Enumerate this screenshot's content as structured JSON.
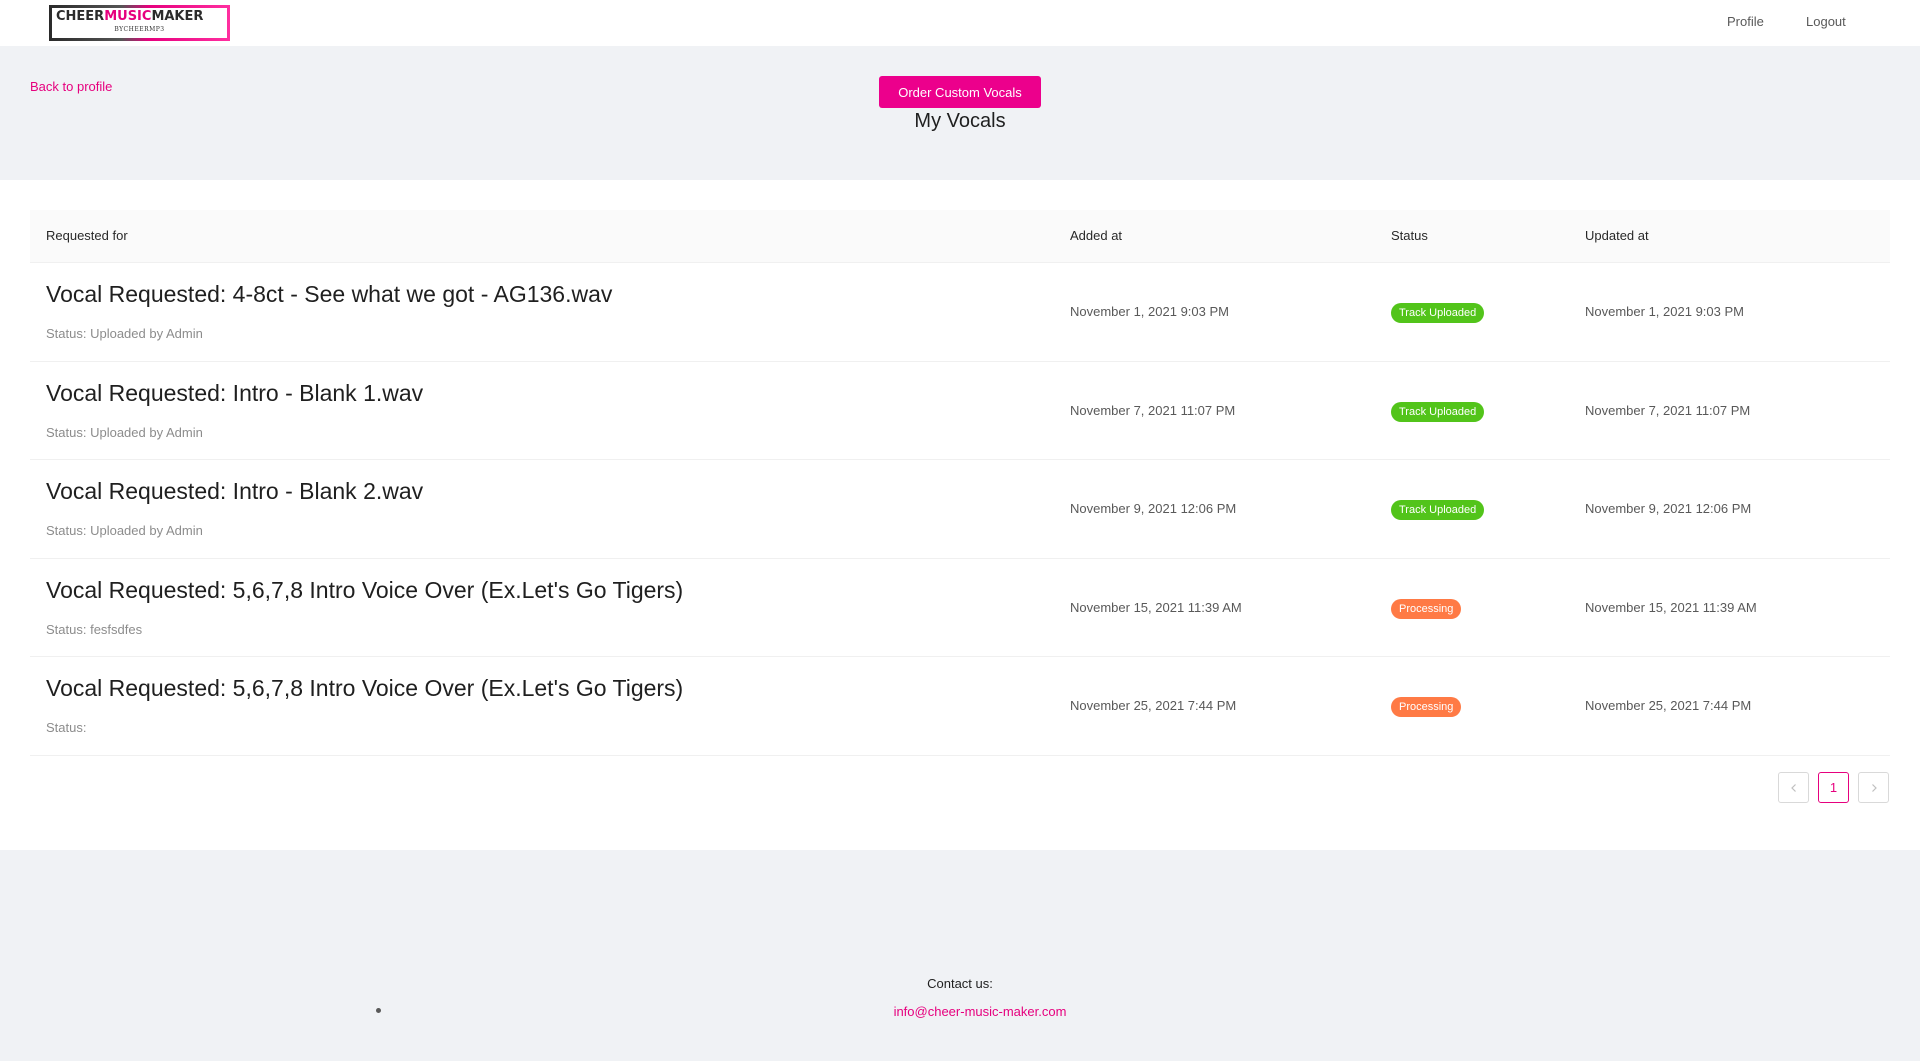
{
  "header": {
    "logo": {
      "part1": "CHEER",
      "part2": "MUSIC",
      "part3": "MAKER",
      "tagline": "BYCHEERMP3"
    },
    "nav": [
      {
        "label": "Profile"
      },
      {
        "label": "Logout"
      }
    ]
  },
  "hero": {
    "back_link": "Back to profile",
    "order_button": "Order Custom Vocals",
    "title": "My Vocals"
  },
  "table": {
    "columns": [
      "Requested for",
      "Added at",
      "Status",
      "Updated at"
    ],
    "rows": [
      {
        "title": "Vocal Requested: 4-8ct - See what we got - AG136.wav",
        "subtitle": "Status: Uploaded by Admin",
        "added_at": "November 1, 2021 9:03 PM",
        "status": "Track Uploaded",
        "status_color": "#52c41a",
        "updated_at": "November 1, 2021 9:03 PM"
      },
      {
        "title": "Vocal Requested: Intro - Blank 1.wav",
        "subtitle": "Status: Uploaded by Admin",
        "added_at": "November 7, 2021 11:07 PM",
        "status": "Track Uploaded",
        "status_color": "#52c41a",
        "updated_at": "November 7, 2021 11:07 PM"
      },
      {
        "title": "Vocal Requested: Intro - Blank 2.wav",
        "subtitle": "Status: Uploaded by Admin",
        "added_at": "November 9, 2021 12:06 PM",
        "status": "Track Uploaded",
        "status_color": "#52c41a",
        "updated_at": "November 9, 2021 12:06 PM"
      },
      {
        "title": "Vocal Requested: 5,6,7,8 Intro Voice Over (Ex.Let's Go Tigers)",
        "subtitle": "Status: fesfsdfes",
        "added_at": "November 15, 2021 11:39 AM",
        "status": "Processing",
        "status_color": "#ff7a45",
        "updated_at": "November 15, 2021 11:39 AM"
      },
      {
        "title": "Vocal Requested: 5,6,7,8 Intro Voice Over (Ex.Let's Go Tigers)",
        "subtitle": "Status:",
        "added_at": "November 25, 2021 7:44 PM",
        "status": "Processing",
        "status_color": "#ff7a45",
        "updated_at": "November 25, 2021 7:44 PM"
      }
    ]
  },
  "pagination": {
    "current_page": "1",
    "prev_icon": "chevron-left-icon",
    "next_icon": "chevron-right-icon"
  },
  "footer": {
    "contact_label": "Contact us:",
    "email": "info@cheer-music-maker.com"
  },
  "colors": {
    "brand": "#ec008c",
    "success": "#52c41a",
    "processing": "#ff7a45"
  }
}
